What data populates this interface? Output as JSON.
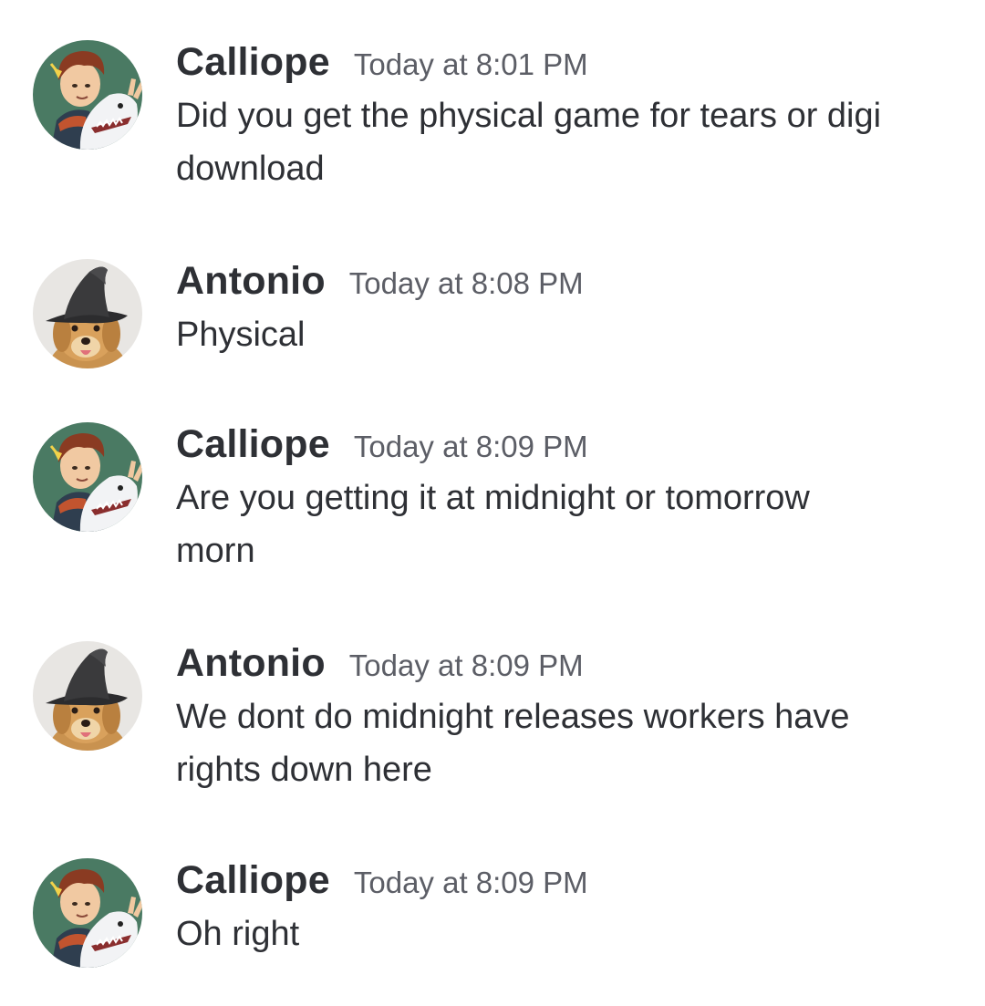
{
  "messages": [
    {
      "author": "Calliope",
      "timestamp": "Today at 8:01 PM",
      "lines": [
        "Did you get the physical game for tears or digi",
        "download"
      ]
    },
    {
      "author": "Antonio",
      "timestamp": "Today at 8:08 PM",
      "lines": [
        "Physical"
      ]
    },
    {
      "author": "Calliope",
      "timestamp": "Today at 8:09 PM",
      "lines": [
        "Are you getting it at midnight or tomorrow",
        "morn"
      ]
    },
    {
      "author": "Antonio",
      "timestamp": "Today at 8:09 PM",
      "lines": [
        "We dont do midnight releases workers have",
        "rights down here"
      ]
    },
    {
      "author": "Calliope",
      "timestamp": "Today at 8:09 PM",
      "lines": [
        "Oh right"
      ]
    }
  ],
  "avatars": {
    "calliope": "cartoon-character-with-shark-avatar",
    "antonio": "dog-in-witch-hat-avatar"
  }
}
